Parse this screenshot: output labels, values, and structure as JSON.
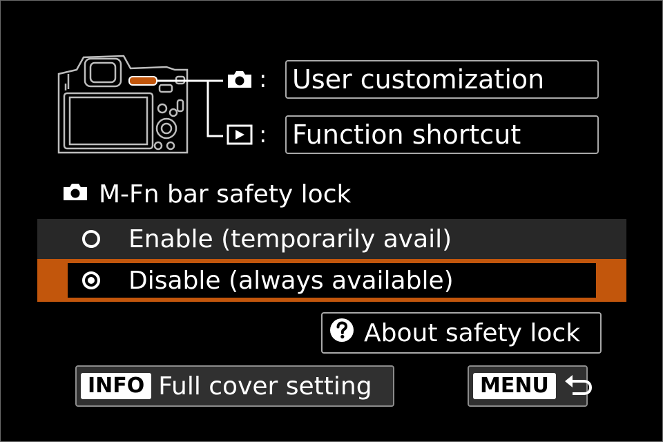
{
  "mapping": {
    "shooting": {
      "icon": "camera-icon",
      "colon": ":",
      "value": "User customization"
    },
    "playback": {
      "icon": "playback-icon",
      "colon": ":",
      "value": "Function shortcut"
    }
  },
  "section": {
    "icon": "camera-icon",
    "title": "M-Fn bar safety lock"
  },
  "options": [
    {
      "label": "Enable (temporarily avail)",
      "selected": false
    },
    {
      "label": "Disable (always available)",
      "selected": true
    }
  ],
  "about_button": {
    "icon": "question-icon",
    "label": "About safety lock"
  },
  "info_button": {
    "key": "INFO",
    "label": "Full cover setting"
  },
  "menu_button": {
    "key": "MENU",
    "icon": "back-arrow-icon"
  },
  "colors": {
    "accent": "#c2560c",
    "background": "#000000",
    "unselected_row": "#282828",
    "border": "#a9a9a9"
  }
}
